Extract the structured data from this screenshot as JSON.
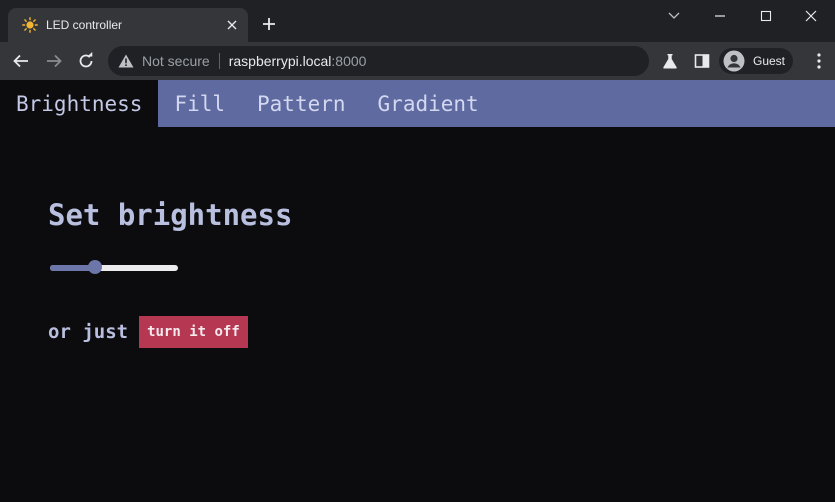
{
  "browser": {
    "tab_title": "LED controller",
    "security_label": "Not secure",
    "url_host": "raspberrypi.local",
    "url_port": ":8000",
    "profile_label": "Guest",
    "favicon": "sun-icon"
  },
  "nav": {
    "tabs": [
      "Brightness",
      "Fill",
      "Pattern",
      "Gradient"
    ],
    "active_index": 0
  },
  "main": {
    "heading": "Set brightness",
    "brightness_fraction": 0.33,
    "or_text": "or just",
    "off_button": "turn it off"
  },
  "colors": {
    "nav_bar": "#5f6aa0",
    "accent": "#6c76a8",
    "danger": "#b63752",
    "page_bg": "#0c0c0f"
  }
}
